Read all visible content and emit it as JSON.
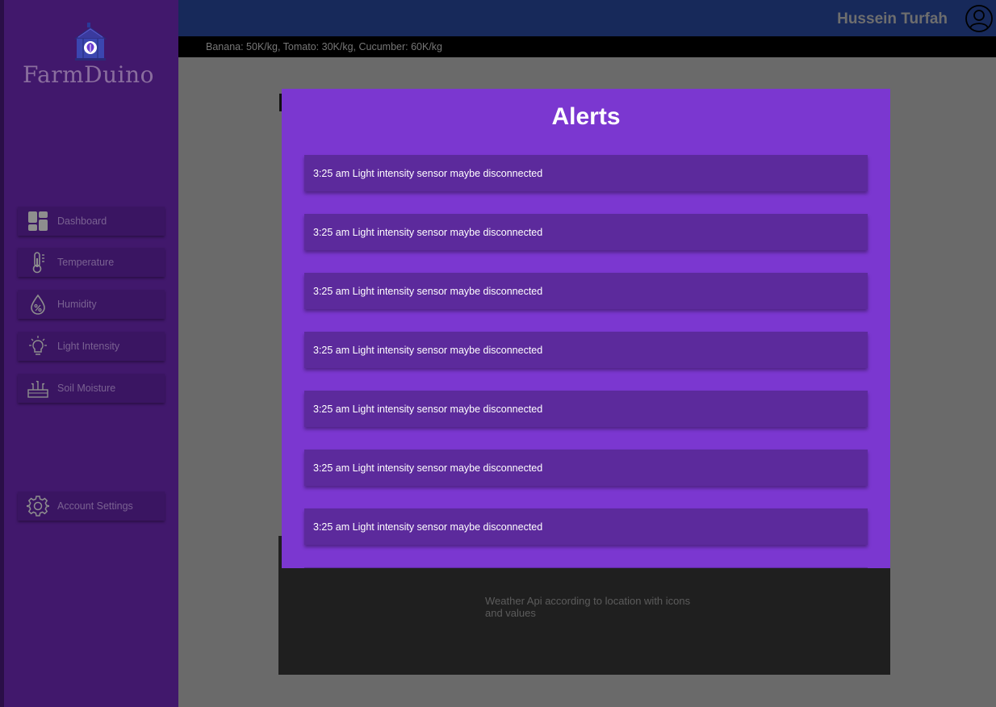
{
  "app": {
    "logo_text": "FarmDuino",
    "logo_icon": "greenhouse-icon"
  },
  "sidebar": {
    "items": [
      {
        "label": "Dashboard",
        "icon": "dashboard-icon"
      },
      {
        "label": "Temperature",
        "icon": "thermometer-icon"
      },
      {
        "label": "Humidity",
        "icon": "humidity-drop-icon"
      },
      {
        "label": "Light Intensity",
        "icon": "light-bulb-icon"
      },
      {
        "label": "Soil Moisture",
        "icon": "soil-moisture-icon"
      }
    ],
    "settings": {
      "label": "Account Settings",
      "icon": "gear-icon"
    }
  },
  "header": {
    "user_name": "Hussein Turfah",
    "avatar_icon": "user-avatar-icon"
  },
  "ticker": {
    "text": "Banana: 50K/kg, Tomato: 30K/kg, Cucumber: 60K/kg"
  },
  "weather_card": {
    "text": "Weather Api according to location with icons and values"
  },
  "modal": {
    "title": "Alerts",
    "alerts": [
      {
        "text": "3:25 am Light intensity sensor maybe disconnected"
      },
      {
        "text": "3:25 am Light intensity sensor maybe disconnected"
      },
      {
        "text": "3:25 am Light intensity sensor maybe disconnected"
      },
      {
        "text": "3:25 am Light intensity sensor maybe disconnected"
      },
      {
        "text": "3:25 am Light intensity sensor maybe disconnected"
      },
      {
        "text": "3:25 am Light intensity sensor maybe disconnected"
      },
      {
        "text": "3:25 am Light intensity sensor maybe disconnected"
      },
      {
        "text": ""
      }
    ]
  },
  "colors": {
    "sidebar": "#41186c",
    "header": "#17295a",
    "modal": "#7b37d0",
    "alert_item": "#5c2a9c"
  }
}
